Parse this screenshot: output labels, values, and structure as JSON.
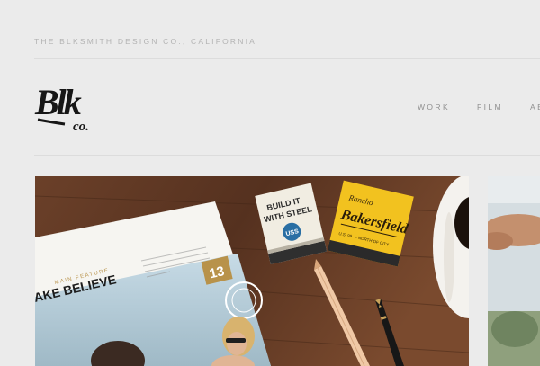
{
  "header": {
    "tagline": "THE BLKSMITH DESIGN CO., CALIFORNIA",
    "logo_text": "Blk",
    "logo_sub": "co."
  },
  "nav": [
    {
      "label": "WORK"
    },
    {
      "label": "FILM"
    },
    {
      "label": "AB"
    }
  ],
  "hero": {
    "magazine": {
      "kicker": "MAIN FEATURE",
      "headline": "AKE BELIEVE",
      "issue_number": "13"
    },
    "matchbook_steel": {
      "line1": "BUILD IT",
      "line2": "WITH STEEL",
      "badge": "USS"
    },
    "matchbook_bakersfield": {
      "script_top": "Rancho",
      "script_main": "Bakersfield",
      "fine_print": "U.S. 99 — NORTH OF CITY"
    }
  },
  "colors": {
    "background": "#ebebeb",
    "wood": "#5a3522",
    "accent_gold": "#b8924a",
    "matchbook_yellow": "#f2c21f"
  }
}
